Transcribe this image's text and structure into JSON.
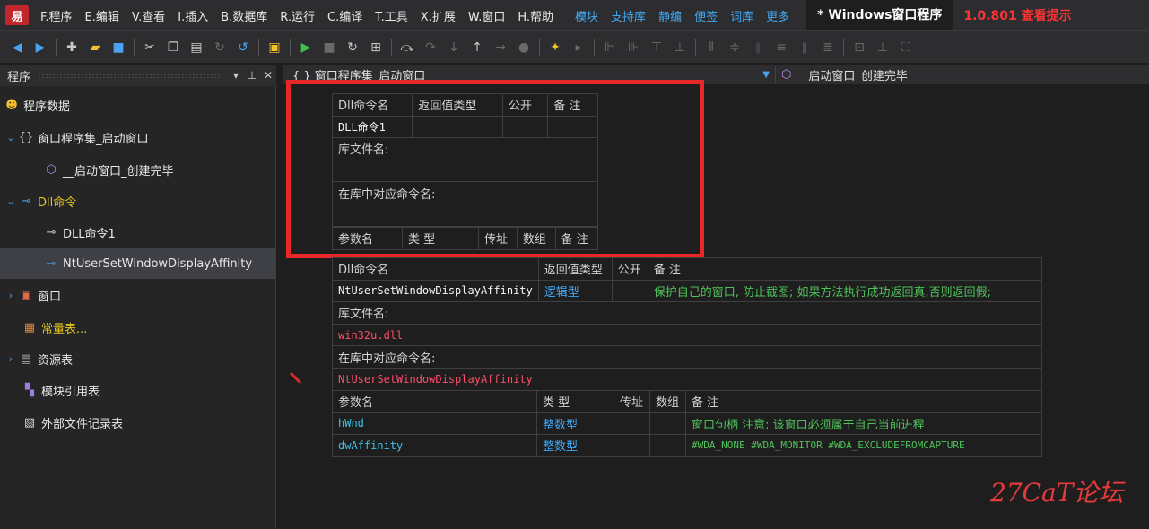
{
  "menubar": {
    "logo": "易",
    "items": [
      {
        "key": "F",
        "label": ".程序"
      },
      {
        "key": "E",
        "label": ".编辑"
      },
      {
        "key": "V",
        "label": ".查看"
      },
      {
        "key": "I",
        "label": ".插入"
      },
      {
        "key": "B",
        "label": ".数据库"
      },
      {
        "key": "R",
        "label": ".运行"
      },
      {
        "key": "C",
        "label": ".编译"
      },
      {
        "key": "T",
        "label": ".工具"
      },
      {
        "key": "X",
        "label": ".扩展"
      },
      {
        "key": "W",
        "label": ".窗口"
      },
      {
        "key": "H",
        "label": ".帮助"
      }
    ],
    "links": [
      "模块",
      "支持库",
      "静编",
      "便签",
      "词库",
      "更多"
    ],
    "title_tab": "* Windows窗口程序",
    "version": "1.0.801 查看提示"
  },
  "left_panel": {
    "header": "程序",
    "tree": [
      {
        "label": "程序数据",
        "icon": "smiley-icon",
        "glyph": "☻",
        "arrow": ""
      },
      {
        "label": "窗口程序集_启动窗口",
        "icon": "braces-icon",
        "glyph": "{}",
        "arrow": "⌄"
      },
      {
        "label": "__启动窗口_创建完毕",
        "icon": "cube-icon",
        "glyph": "⬡",
        "arrow": ""
      },
      {
        "label": "Dll命令",
        "icon": "plug-icon",
        "glyph": "⊸",
        "arrow": "⌄"
      },
      {
        "label": "DLL命令1",
        "icon": "plug-icon",
        "glyph": "⊸",
        "arrow": ""
      },
      {
        "label": "NtUserSetWindowDisplayAffinity",
        "icon": "plug-icon",
        "glyph": "⊸",
        "arrow": ""
      },
      {
        "label": "窗口",
        "icon": "window-icon",
        "glyph": "▣",
        "arrow": "›"
      },
      {
        "label": "常量表...",
        "icon": "constant-table-icon",
        "glyph": "▦",
        "arrow": ""
      },
      {
        "label": "资源表",
        "icon": "resource-icon",
        "glyph": "▤",
        "arrow": "›"
      },
      {
        "label": "模块引用表",
        "icon": "module-icon",
        "glyph": "▚",
        "arrow": ""
      },
      {
        "label": "外部文件记录表",
        "icon": "file-record-icon",
        "glyph": "▧",
        "arrow": ""
      }
    ]
  },
  "editor_header": {
    "left": "{ } 窗口程序集_启动窗口",
    "right": "__启动窗口_创建完毕"
  },
  "table1": {
    "headers": [
      "Dll命令名",
      "返回值类型",
      "公开",
      "备 注"
    ],
    "name": "DLL命令1",
    "lib_label": "库文件名:",
    "lib_value": "",
    "cmd_label": "在库中对应命令名:",
    "cmd_value": "",
    "param_headers": [
      "参数名",
      "类 型",
      "传址",
      "数组",
      "备 注"
    ]
  },
  "table2": {
    "headers": [
      "Dll命令名",
      "返回值类型",
      "公开",
      "备 注"
    ],
    "name": "NtUserSetWindowDisplayAffinity",
    "return_type": "逻辑型",
    "comment": "保护自己的窗口, 防止截图; 如果方法执行成功返回真,否则返回假;",
    "lib_label": "库文件名:",
    "lib_value": "win32u.dll",
    "cmd_label": "在库中对应命令名:",
    "cmd_value": "NtUserSetWindowDisplayAffinity",
    "param_headers": [
      "参数名",
      "类 型",
      "传址",
      "数组",
      "备 注"
    ],
    "params": [
      {
        "name": "hWnd",
        "type": "整数型",
        "comment": "窗口句柄 注意: 该窗口必须属于自己当前进程"
      },
      {
        "name": "dwAffinity",
        "type": "整数型",
        "comment": "#WDA_NONE #WDA_MONITOR #WDA_EXCLUDEFROMCAPTURE"
      }
    ]
  },
  "watermark": "27CaT论坛"
}
